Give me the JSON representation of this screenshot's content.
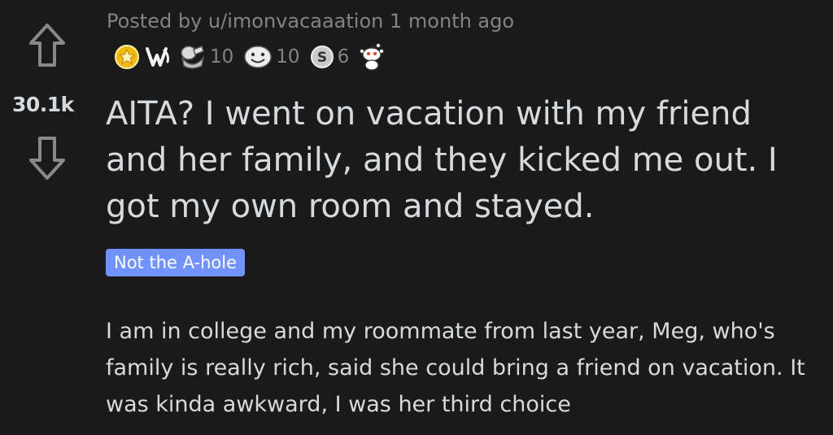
{
  "post": {
    "meta_prefix": "Posted by",
    "author": "u/imonvacaaation",
    "age": "1 month ago",
    "score": "30.1k",
    "title": "AITA? I went on vacation with my friend and her family, and they kicked me out. I got my own room and stayed.",
    "flair": "Not the A-hole",
    "body": "I am in college and my roommate from last year, Meg, who's family is really rich, said she could bring a friend on vacation. It was kinda awkward, I was her third choice"
  },
  "awards": [
    {
      "icon": "gold-award-icon",
      "count": ""
    },
    {
      "icon": "hands-award-icon",
      "count": ""
    },
    {
      "icon": "hug-award-icon",
      "count": "10"
    },
    {
      "icon": "smile-award-icon",
      "count": "10"
    },
    {
      "icon": "silver-award-icon",
      "count": "6"
    },
    {
      "icon": "snoo-award-icon",
      "count": ""
    }
  ],
  "colors": {
    "background": "#1a1a1b",
    "text": "#d7dadc",
    "muted": "#818384",
    "flair_bg": "#7193ff"
  }
}
